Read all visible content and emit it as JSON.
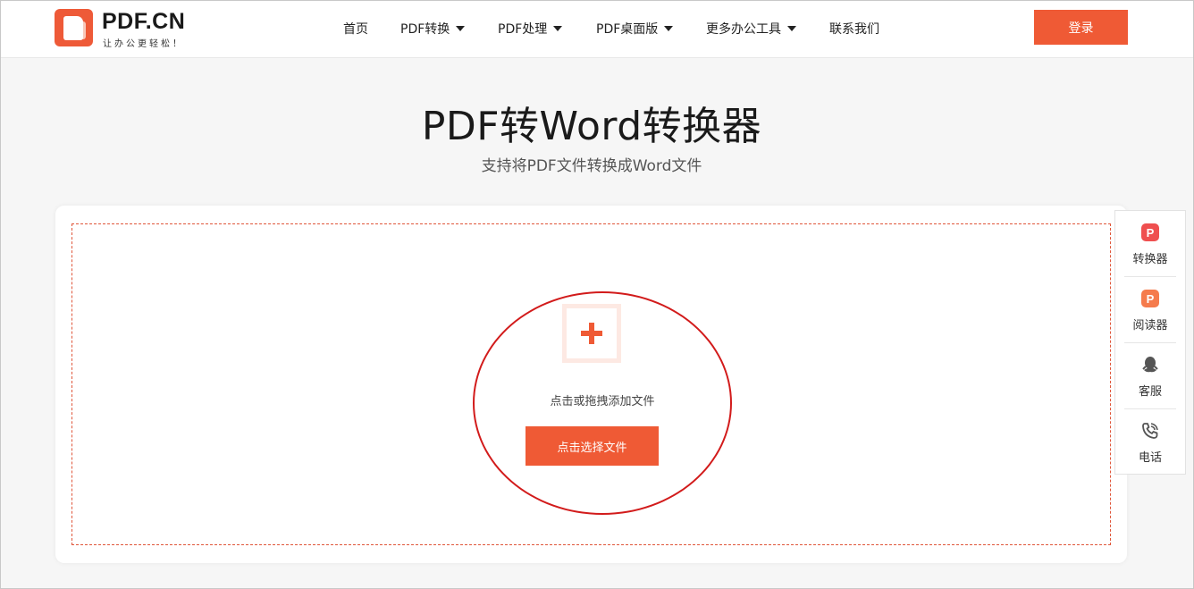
{
  "brand": {
    "name": "PDF.CN",
    "slogan": "让办公更轻松！",
    "accent": "#ef5a35"
  },
  "nav": {
    "items": [
      {
        "label": "首页",
        "has_dropdown": false
      },
      {
        "label": "PDF转换",
        "has_dropdown": true
      },
      {
        "label": "PDF处理",
        "has_dropdown": true
      },
      {
        "label": "PDF桌面版",
        "has_dropdown": true
      },
      {
        "label": "更多办公工具",
        "has_dropdown": true
      },
      {
        "label": "联系我们",
        "has_dropdown": false
      }
    ],
    "login_label": "登录"
  },
  "hero": {
    "title": "PDF转Word转换器",
    "subtitle": "支持将PDF文件转换成Word文件"
  },
  "upload": {
    "hint": "点击或拖拽添加文件",
    "button_label": "点击选择文件",
    "add_icon": "plus-icon",
    "annotation_color": "#d21b1b"
  },
  "sidebar": {
    "items": [
      {
        "label": "转换器",
        "icon": "converter-icon"
      },
      {
        "label": "阅读器",
        "icon": "reader-icon"
      },
      {
        "label": "客服",
        "icon": "qq-icon"
      },
      {
        "label": "电话",
        "icon": "phone-icon"
      }
    ]
  }
}
